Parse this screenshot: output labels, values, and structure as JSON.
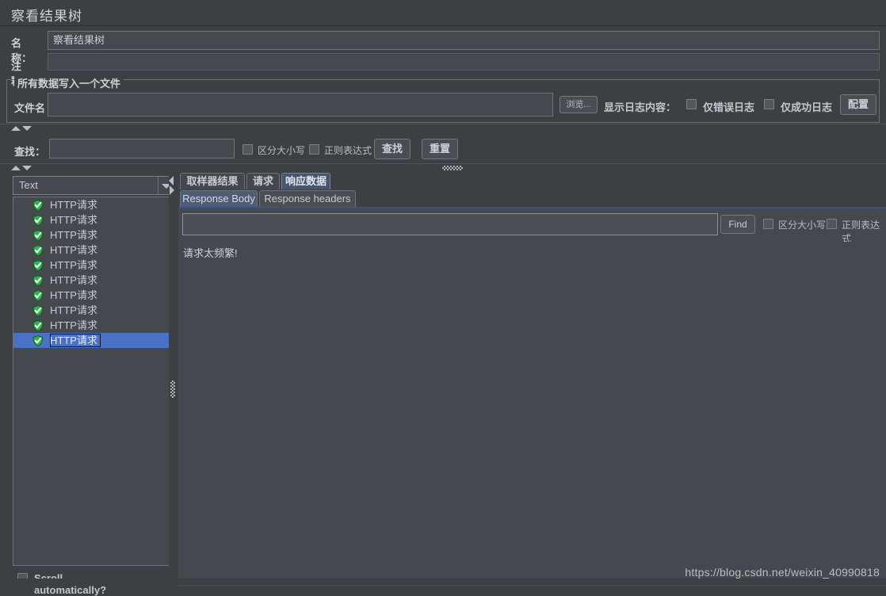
{
  "window": {
    "title": "察看结果树"
  },
  "fields": {
    "name_label": "名称：",
    "name_value": "察看结果树",
    "comment_label": "注释：",
    "comment_value": ""
  },
  "filegroup": {
    "legend": "所有数据写入一个文件",
    "filename_label": "文件名",
    "filename_value": "",
    "browse_button": "浏览...",
    "log_display_label": "显示日志内容：",
    "errors_only_label": "仅错误日志",
    "success_only_label": "仅成功日志",
    "configure_button": "配置"
  },
  "search": {
    "label": "查找：",
    "value": "",
    "case_sensitive_label": "区分大小写",
    "regex_label": "正则表达式",
    "find_button": "查找",
    "reset_button": "重置"
  },
  "left": {
    "render_combo_value": "Text",
    "tree_items": [
      {
        "label": "HTTP请求",
        "status": "success",
        "selected": false
      },
      {
        "label": "HTTP请求",
        "status": "success",
        "selected": false
      },
      {
        "label": "HTTP请求",
        "status": "success",
        "selected": false
      },
      {
        "label": "HTTP请求",
        "status": "success",
        "selected": false
      },
      {
        "label": "HTTP请求",
        "status": "success",
        "selected": false
      },
      {
        "label": "HTTP请求",
        "status": "success",
        "selected": false
      },
      {
        "label": "HTTP请求",
        "status": "success",
        "selected": false
      },
      {
        "label": "HTTP请求",
        "status": "success",
        "selected": false
      },
      {
        "label": "HTTP请求",
        "status": "success",
        "selected": false
      },
      {
        "label": "HTTP请求",
        "status": "success",
        "selected": true
      }
    ],
    "scroll_automatically_label": "Scroll automatically?"
  },
  "right": {
    "tabs": [
      {
        "label": "取样器结果",
        "active": false
      },
      {
        "label": "请求",
        "active": false
      },
      {
        "label": "响应数据",
        "active": true
      }
    ],
    "subtabs": [
      {
        "label": "Response Body",
        "active": true
      },
      {
        "label": "Response headers",
        "active": false
      }
    ],
    "find_value": "",
    "find_button": "Find",
    "case_sensitive_label": "区分大小写",
    "regex_label": "正则表达式",
    "response_body_text": "请求太频繁!"
  },
  "watermark": "https://blog.csdn.net/weixin_40990818",
  "colors": {
    "background": "#3c4043",
    "field": "#45494d",
    "accent_selection": "#4a72c4",
    "tab_active": "#48556e",
    "success_icon": "#2fb34a",
    "text": "#c8cdd2"
  }
}
